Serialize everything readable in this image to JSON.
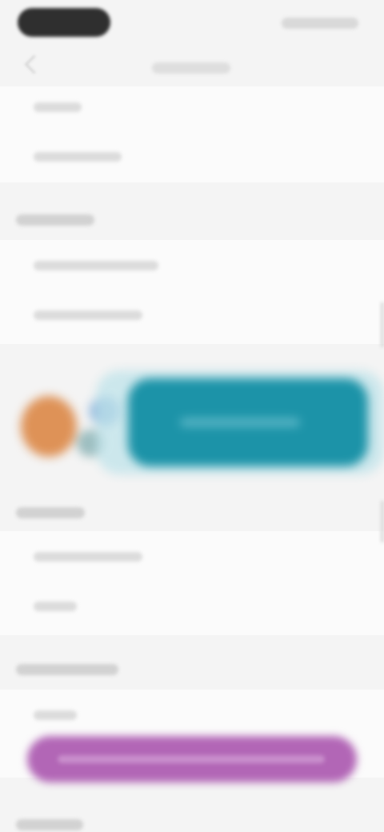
{
  "status_bar": {
    "time": "",
    "icons": [
      "signal-icon",
      "wifi-icon",
      "battery-icon"
    ]
  },
  "nav": {
    "title": ""
  },
  "sections": [
    {
      "title": "",
      "items": [
        {
          "label": ""
        },
        {
          "label": ""
        }
      ]
    },
    {
      "title": "",
      "items": [
        {
          "label": ""
        },
        {
          "label": ""
        }
      ]
    },
    {
      "title": "",
      "items": [
        {
          "label": ""
        },
        {
          "label": ""
        }
      ]
    },
    {
      "title": "",
      "items": [
        {
          "label": ""
        }
      ]
    },
    {
      "title": ""
    }
  ],
  "promo": {
    "button_label": ""
  },
  "cta": {
    "button_label": ""
  },
  "colors": {
    "background": "#f4f4f4",
    "teal_button": "#1c93a8",
    "pink_button": "#b266b6",
    "orange_shape": "#de9257"
  }
}
